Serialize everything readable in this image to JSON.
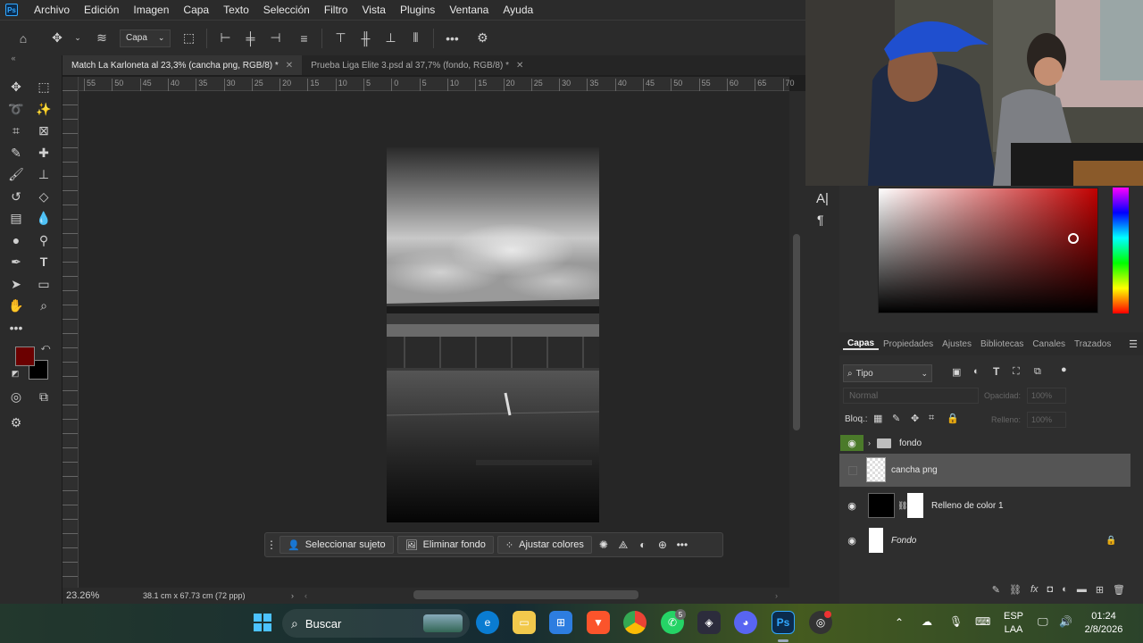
{
  "app": {
    "logo": "Ps",
    "menu": [
      "Archivo",
      "Edición",
      "Imagen",
      "Capa",
      "Texto",
      "Selección",
      "Filtro",
      "Vista",
      "Plugins",
      "Ventana",
      "Ayuda"
    ]
  },
  "options": {
    "select_value": "Capa"
  },
  "tabs": [
    {
      "label": "Match La Karloneta al 23,3% (cancha png, RGB/8) *",
      "active": true
    },
    {
      "label": "Prueba Liga Elite 3.psd al 37,7% (fondo, RGB/8) *",
      "active": false
    }
  ],
  "ruler": {
    "top_ticks": [
      "55",
      "50",
      "45",
      "40",
      "35",
      "30",
      "25",
      "20",
      "15",
      "10",
      "5",
      "0",
      "5",
      "10",
      "15",
      "20",
      "25",
      "30",
      "35",
      "40",
      "45",
      "50",
      "55",
      "60",
      "65",
      "70"
    ]
  },
  "colors": {
    "foreground": "#6b0000",
    "background": "#000000"
  },
  "context_bar": {
    "select_subject": "Seleccionar sujeto",
    "remove_bg": "Eliminar fondo",
    "adjust_colors": "Ajustar colores"
  },
  "status": {
    "zoom": "23.26%",
    "doc_size": "38.1 cm x 67.73 cm (72 ppp)"
  },
  "side_strip": {
    "char_glyph": "A|",
    "para_glyph": "¶"
  },
  "layers_panel": {
    "tabs": [
      "Capas",
      "Propiedades",
      "Ajustes",
      "Bibliotecas",
      "Canales",
      "Trazados"
    ],
    "filter_label": "Tipo",
    "blend_mode": "Normal",
    "opacity_label": "Opacidad:",
    "opacity_value": "100%",
    "lock_label": "Bloq.:",
    "fill_label": "Relleno:",
    "fill_value": "100%",
    "layers": [
      {
        "name": "fondo",
        "visible": true
      },
      {
        "name": "cancha png",
        "visible": false
      },
      {
        "name": "Relleno de color 1",
        "visible": true
      },
      {
        "name": "Fondo",
        "visible": true
      }
    ]
  },
  "taskbar": {
    "search_placeholder": "Buscar",
    "whatsapp_badge": "5",
    "lang_line1": "ESP",
    "lang_line2": "LAA",
    "time": "01:24",
    "date": "2/8/2026"
  }
}
